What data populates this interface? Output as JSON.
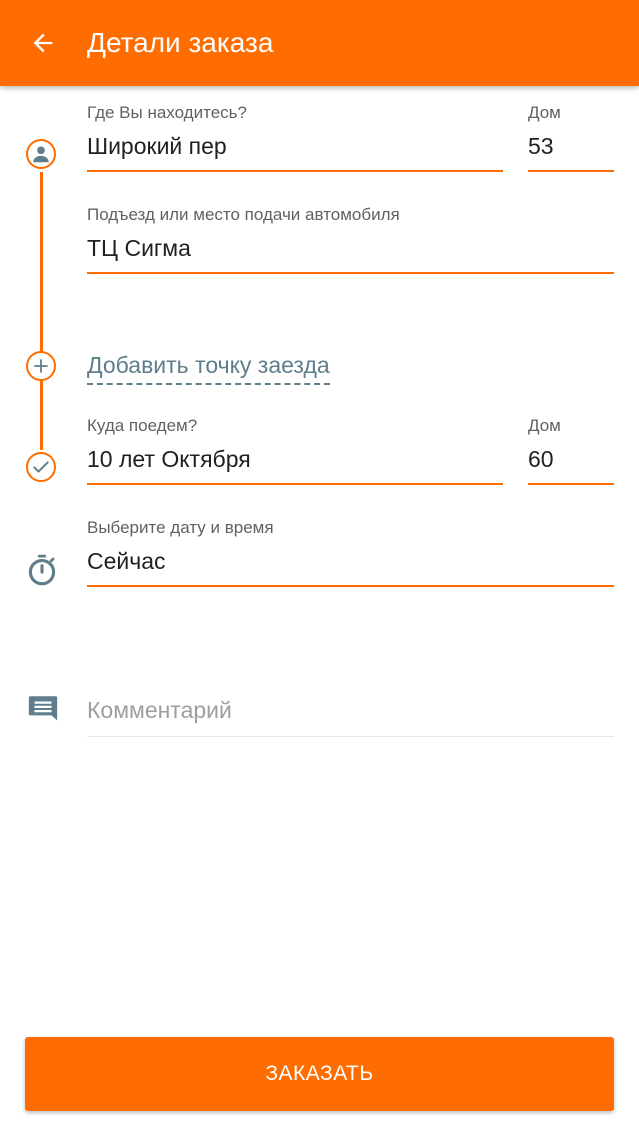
{
  "app_bar": {
    "title": "Детали заказа",
    "back_icon": "arrow-left-icon",
    "color": "#ff6d00"
  },
  "pickup": {
    "label": "Где Вы находитесь?",
    "street": "Широкий пер",
    "house_label": "Дом",
    "house": "53",
    "icon": "person-icon"
  },
  "entrance": {
    "label": "Подъезд или место подачи автомобиля",
    "value": "ТЦ Сигма"
  },
  "add_stop": {
    "label": "Добавить точку заезда",
    "icon": "plus-circle-icon"
  },
  "destination": {
    "label": "Куда поедем?",
    "street": "10 лет Октября",
    "house_label": "Дом",
    "house": "60",
    "icon": "check-circle-icon"
  },
  "datetime": {
    "label": "Выберите дату и время",
    "value": "Сейчас",
    "icon": "timer-icon"
  },
  "comment": {
    "placeholder": "Комментарий",
    "icon": "comment-icon"
  },
  "order_button": {
    "label": "ЗАКАЗАТЬ"
  },
  "colors": {
    "accent": "#ff6d00",
    "icon_gray": "#607d8b"
  }
}
